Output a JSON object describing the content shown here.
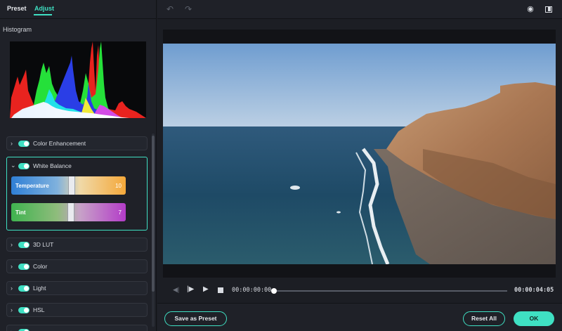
{
  "tabs": [
    {
      "label": "Preset"
    },
    {
      "label": "Adjust",
      "active": true
    }
  ],
  "histogram": {
    "title": "Histogram"
  },
  "sections": [
    {
      "label": "Color Enhancement",
      "enabled": true,
      "expanded": false
    },
    {
      "label": "White Balance",
      "enabled": true,
      "expanded": true
    },
    {
      "label": "3D LUT",
      "enabled": true,
      "expanded": false
    },
    {
      "label": "Color",
      "enabled": true,
      "expanded": false
    },
    {
      "label": "Light",
      "enabled": true,
      "expanded": false
    },
    {
      "label": "HSL",
      "enabled": true,
      "expanded": false
    }
  ],
  "white_balance": {
    "temperature": {
      "label": "Temperature",
      "value": "10"
    },
    "tint": {
      "label": "Tint",
      "value": "7"
    }
  },
  "player": {
    "current_time": "00:00:00:00",
    "duration": "00:00:04:05",
    "progress": 0
  },
  "buttons": {
    "save_preset": "Save as Preset",
    "reset_all": "Reset All",
    "ok": "OK"
  },
  "colors": {
    "accent": "#3fe0c3",
    "background": "#1c1e24",
    "panel": "#1f2128"
  },
  "icons": [
    "undo-icon",
    "redo-icon",
    "eye-icon",
    "compare-icon",
    "prev-frame-icon",
    "step-play-icon",
    "play-icon",
    "stop-icon",
    "chevron-right-icon",
    "chevron-down-icon"
  ]
}
